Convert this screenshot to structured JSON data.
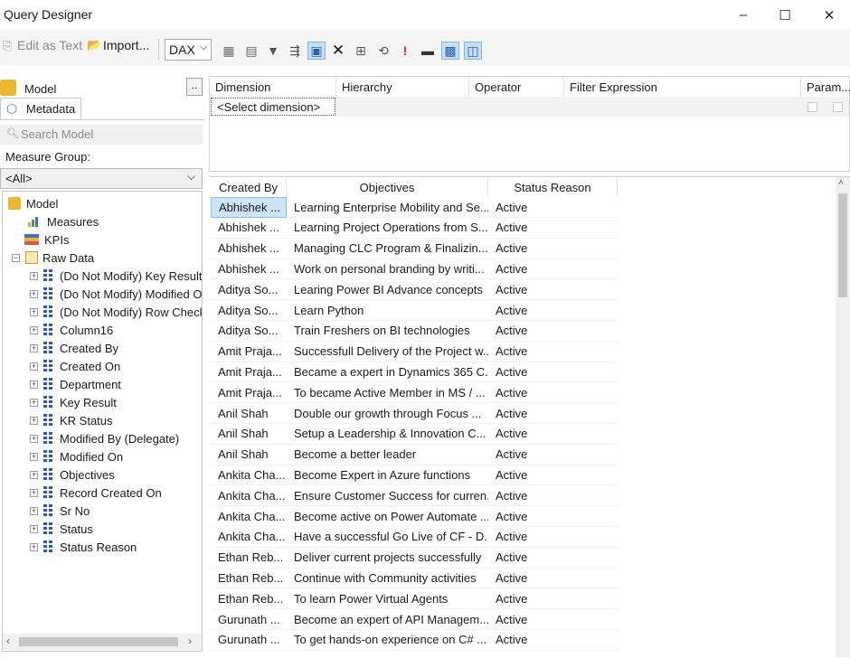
{
  "window": {
    "title": "Query Designer",
    "minimize": "–",
    "maximize": "☐",
    "close": "✕"
  },
  "toolbar": {
    "edit_as_text": "Edit as Text",
    "import": "Import...",
    "language": "DAX",
    "icons": [
      "add-table-icon",
      "table-icon",
      "filter-icon",
      "parameter-icon",
      "show-grid-icon",
      "delete-icon",
      "calculated-member-icon",
      "refresh-icon",
      "exclamation-icon",
      "design-mode-icon",
      "auto-execute-icon",
      "show-empty-cells-icon"
    ]
  },
  "left": {
    "model_label": "Model",
    "browse_button": "..",
    "metadata_tab": "Metadata",
    "search_placeholder": "Search Model",
    "measure_group_label": "Measure Group:",
    "measure_group_value": "<All>",
    "tree": {
      "root": "Model",
      "measures": "Measures",
      "kpis": "KPIs",
      "raw_data": "Raw Data",
      "columns": [
        "(Do Not Modify) Key Result",
        "(Do Not Modify) Modified On",
        "(Do Not Modify) Row Checksum",
        "Column16",
        "Created By",
        "Created On",
        "Department",
        "Key Result",
        "KR Status",
        "Modified By (Delegate)",
        "Modified On",
        "Objectives",
        "Record Created On",
        "Sr No",
        "Status",
        "Status Reason"
      ]
    }
  },
  "filter": {
    "headers": [
      "Dimension",
      "Hierarchy",
      "Operator",
      "Filter Expression",
      "Param..."
    ],
    "select_dimension": "<Select dimension>"
  },
  "results": {
    "headers": [
      "Created By",
      "Objectives",
      "Status Reason"
    ],
    "rows": [
      [
        "Abhishek ...",
        "Learning Enterprise Mobility and Se...",
        "Active"
      ],
      [
        "Abhishek ...",
        "Learning Project Operations from S...",
        "Active"
      ],
      [
        "Abhishek ...",
        "Managing CLC Program & Finalizin...",
        "Active"
      ],
      [
        "Abhishek ...",
        "Work on personal branding by writi...",
        "Active"
      ],
      [
        "Aditya So...",
        "Learing Power BI Advance concepts",
        "Active"
      ],
      [
        "Aditya So...",
        "Learn Python",
        "Active"
      ],
      [
        "Aditya So...",
        "Train Freshers on BI technologies",
        "Active"
      ],
      [
        "Amit Praja...",
        "Successfull Delivery of the Project w...",
        "Active"
      ],
      [
        "Amit Praja...",
        "Became a expert in Dynamics 365 C...",
        "Active"
      ],
      [
        "Amit Praja...",
        "To became Active Member in MS / ...",
        "Active"
      ],
      [
        "Anil Shah",
        "Double our growth through Focus ...",
        "Active"
      ],
      [
        "Anil Shah",
        "Setup a Leadership & Innovation C...",
        "Active"
      ],
      [
        "Anil Shah",
        "Become a better leader",
        "Active"
      ],
      [
        "Ankita Cha...",
        "Become Expert in Azure functions",
        "Active"
      ],
      [
        "Ankita Cha...",
        "Ensure Customer Success for curren...",
        "Active"
      ],
      [
        "Ankita Cha...",
        "Become active on Power Automate ...",
        "Active"
      ],
      [
        "Ankita Cha...",
        "Have a successful Go Live of CF - D...",
        "Active"
      ],
      [
        "Ethan Reb...",
        "Deliver current projects successfully",
        "Active"
      ],
      [
        "Ethan Reb...",
        "Continue with Community activities",
        "Active"
      ],
      [
        "Ethan Reb...",
        "To learn Power Virtual Agents",
        "Active"
      ],
      [
        "Gurunath ...",
        "Become an expert of API Managem...",
        "Active"
      ],
      [
        "Gurunath ...",
        "To get hands-on experience on C# ...",
        "Active"
      ]
    ]
  }
}
